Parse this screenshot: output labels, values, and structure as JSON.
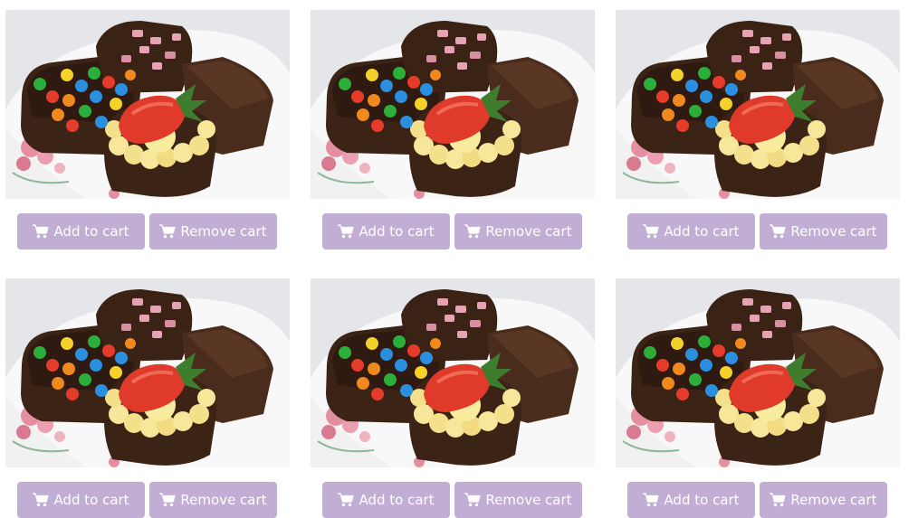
{
  "products": [
    {
      "image": "brownies-dessert-plate",
      "add_label": "Add to cart",
      "remove_label": "Remove cart",
      "add_icon": "cart-icon",
      "remove_icon": "cart-icon"
    },
    {
      "image": "brownies-dessert-plate",
      "add_label": "Add to cart",
      "remove_label": "Remove cart",
      "add_icon": "cart-icon",
      "remove_icon": "cart-icon"
    },
    {
      "image": "brownies-dessert-plate",
      "add_label": "Add to cart",
      "remove_label": "Remove cart",
      "add_icon": "cart-icon",
      "remove_icon": "cart-icon"
    },
    {
      "image": "brownies-dessert-plate",
      "add_label": "Add to cart",
      "remove_label": "Remove cart",
      "add_icon": "cart-icon",
      "remove_icon": "cart-icon"
    },
    {
      "image": "brownies-dessert-plate",
      "add_label": "Add to cart",
      "remove_label": "Remove cart",
      "add_icon": "cart-icon",
      "remove_icon": "cart-icon"
    },
    {
      "image": "brownies-dessert-plate",
      "add_label": "Add to cart",
      "remove_label": "Remove cart",
      "add_icon": "cart-icon",
      "remove_icon": "cart-icon"
    }
  ],
  "colors": {
    "button_bg": "#c2aed4",
    "button_text": "#ffffff"
  }
}
